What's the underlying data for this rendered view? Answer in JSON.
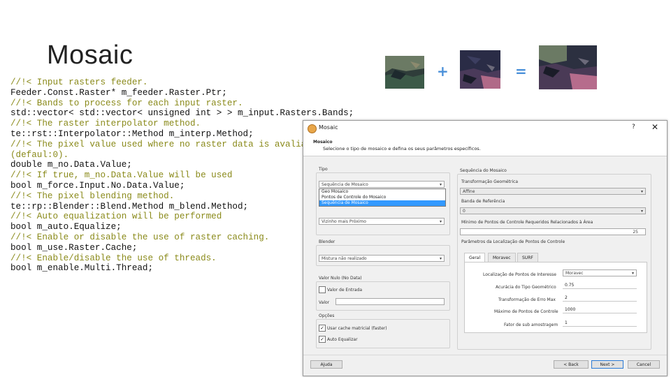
{
  "slide": {
    "title": "Mosaic",
    "code_lines": [
      {
        "text": "//!< Input rasters feeder.",
        "kind": "comment"
      },
      {
        "text": "Feeder.Const.Raster* m_feeder.Raster.Ptr;",
        "kind": "code"
      },
      {
        "text": "//!< Bands to process for each input raster.",
        "kind": "comment"
      },
      {
        "text": "std::vector< std::vector< unsigned int > > m_input.Rasters.Bands;",
        "kind": "code"
      },
      {
        "text": "//!< The raster interpolator method.",
        "kind": "comment"
      },
      {
        "text": "te::rst::Interpolator::Method m_interp.Method;",
        "kind": "code"
      },
      {
        "text": "//!< The pixel value used where no raster data is avaliable",
        "kind": "comment"
      },
      {
        "text": "(defaul:0).",
        "kind": "comment"
      },
      {
        "text": "double m_no.Data.Value;",
        "kind": "code"
      },
      {
        "text": "//!< If true, m_no.Data.Value will be used",
        "kind": "comment"
      },
      {
        "text": "bool m_force.Input.No.Data.Value;",
        "kind": "code"
      },
      {
        "text": "//!< The pixel blending method.",
        "kind": "comment"
      },
      {
        "text": "te::rp::Blender::Blend.Method m_blend.Method;",
        "kind": "code"
      },
      {
        "text": "//!< Auto equalization will be performed",
        "kind": "comment"
      },
      {
        "text": "bool m_auto.Equalize;",
        "kind": "code"
      },
      {
        "text": "//!< Enable or disable the use of raster caching.",
        "kind": "comment"
      },
      {
        "text": "bool m_use.Raster.Cache;",
        "kind": "code"
      },
      {
        "text": "//!< Enable/disable the use of threads.",
        "kind": "comment"
      },
      {
        "text": "bool m_enable.Multi.Thread;",
        "kind": "code"
      }
    ],
    "operators": {
      "plus": "+",
      "equals": "="
    },
    "colors": {
      "plus": "#4a90d9",
      "equals": "#4a90d9",
      "comment": "#8a8a1a"
    }
  },
  "dialog": {
    "title": "Mosaic",
    "help": "?",
    "close": "✕",
    "header_title": "Mosaico",
    "header_sub": "Selecione o tipo de mosaico e defina os seus parâmetros específicos.",
    "tipo_label": "Tipo",
    "tipo_combo": "Sequência de Mosaico",
    "tipo_options": [
      "Geo Mosaico",
      "Pontos de Controle do Mosaico",
      "Sequência de Mosaico"
    ],
    "interp_combo": "Vizinho mais Próximo",
    "blender_label": "Blender",
    "blender_combo": "Mistura não realizado",
    "nodata_label": "Valor Nulo (No Data)",
    "nodata_check": "Valor de Entrada",
    "valor_label": "Valor",
    "options_label": "Opções",
    "opt_cache": "Usar cache matricial (faster)",
    "opt_equalize": "Auto Equalizar",
    "seq_label": "Sequência do Mosaico",
    "transf_label": "Transformação Geométrica",
    "transf_combo": "Affine",
    "banda_label": "Banda de Referência",
    "banda_combo": "0",
    "min_label": "Mínimo de Pontos de Controle Requeridos Relacionados à Área",
    "min_value": "25",
    "params_label": "Parâmetros da Localização de Pontos de Controle",
    "tabs": [
      "Geral",
      "Moravec",
      "SURF"
    ],
    "fields": [
      {
        "label": "Localização de Pontos de Interesse",
        "value": "Moravec"
      },
      {
        "label": "Acurácia do Tipo Geométrico",
        "value": "0.75"
      },
      {
        "label": "Transformação de Erro Max",
        "value": "2"
      },
      {
        "label": "Máximo de Pontos de Controle",
        "value": "1000"
      },
      {
        "label": "Fator de sub amostragem",
        "value": "1"
      }
    ],
    "btn_help": "Ajuda",
    "btn_back": "< Back",
    "btn_next": "Next >",
    "btn_cancel": "Cancel"
  }
}
